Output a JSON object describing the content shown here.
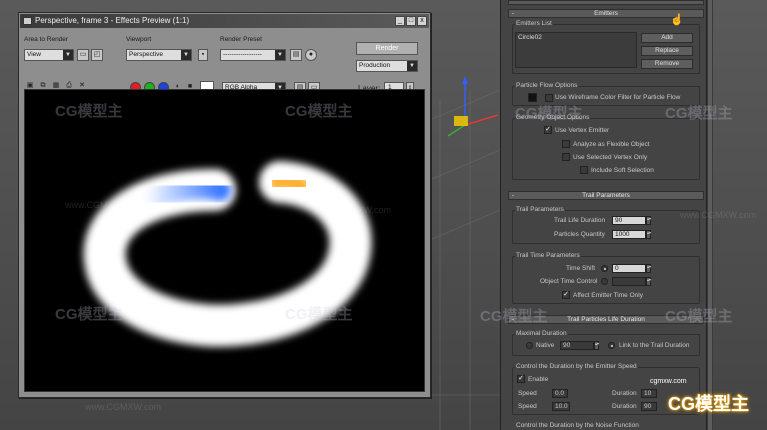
{
  "preview": {
    "title": "Perspective, frame 3 - Effects Preview (1:1)",
    "area_to_render_label": "Area to Render",
    "area_to_render_value": "View",
    "viewport_label": "Viewport",
    "viewport_value": "Perspective",
    "render_preset_label": "Render Preset",
    "render_preset_value": "------------------",
    "render_button": "Render",
    "production_value": "Production",
    "channel_value": "RGB Alpha",
    "layer_label": "Layer:",
    "layer_value": "1",
    "win_min": "_",
    "win_max": "□",
    "win_close": "x"
  },
  "watermarks": {
    "logo": "CG模型主",
    "url": "www.CGMXW.com"
  },
  "panel": {
    "emitters_rollout": "Emitters",
    "emitters_list_label": "Emitters List",
    "emitters_list_items": [
      "Circle02"
    ],
    "add_button": "Add",
    "replace_button": "Replace",
    "remove_button": "Remove",
    "particle_flow_label": "Particle Flow Options",
    "use_wireframe_color": "Use Wireframe Color Filter for Particle Flow",
    "geometry_options_label": "Geometry Object Options",
    "use_vertex_emitter": "Use Vertex Emitter",
    "analyze_flexible": "Analyze as Flexible Object",
    "use_selected_vertex": "Use Selected Vertex Only",
    "include_soft_selection": "Include Soft Selection",
    "trail_parameters_rollout": "Trail Parameters",
    "trail_parameters_label": "Trail Parameters",
    "trail_life_duration_label": "Trail Life Duration",
    "trail_life_duration_value": "90",
    "particles_quantity_label": "Particles Quantity",
    "particles_quantity_value": "1000",
    "trail_time_params_label": "Trail Time Parameters",
    "time_shift_label": "Time Shift",
    "time_shift_value": "0",
    "object_time_control_label": "Object Time Control",
    "affect_emitter_time": "Affect Emitter Time Only",
    "trail_particles_life_rollout": "Trail Particles Life Duration",
    "maximal_duration_label": "Maximal Duration",
    "native_label": "Native",
    "native_value": "90",
    "link_to_trail": "Link to the Trail Duration",
    "control_emitter_speed_label": "Control the Duration by the Emitter Speed",
    "enable_label": "Enable",
    "min_speed_label": "Speed",
    "min_speed_value": "0.0",
    "min_duration_label": "Duration",
    "min_duration_value": "10",
    "max_speed_label": "Speed",
    "max_speed_value": "10.0",
    "max_duration_label": "Duration",
    "max_duration_value": "90",
    "control_noise_label": "Control the Duration by the Noise Function"
  },
  "brand": {
    "url": "cgmxw.com",
    "logo": "CG模型主"
  },
  "colors": {
    "accent_render_white": "#ffffff",
    "accent_render_blue": "#3a78ff",
    "accent_render_orange": "#ffb030"
  }
}
